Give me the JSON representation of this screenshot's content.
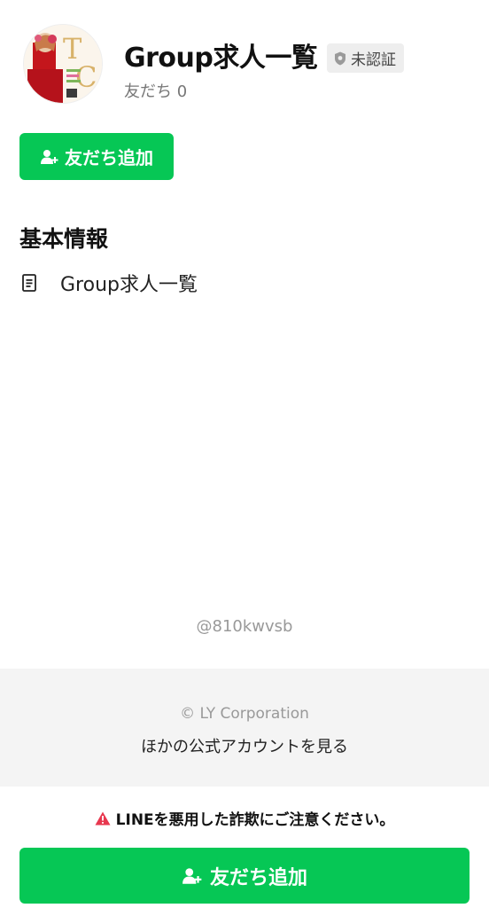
{
  "header": {
    "title": "Group求人一覧",
    "badge_label": "未認証",
    "friends_count": "友だち 0"
  },
  "actions": {
    "add_friend_label": "友だち追加"
  },
  "basic_info": {
    "section_title": "基本情報",
    "items": [
      {
        "icon": "document-icon",
        "text": "Group求人一覧"
      }
    ]
  },
  "account_id": "@810kwvsb",
  "footer": {
    "copyright": "© LY Corporation",
    "other_accounts_link": "ほかの公式アカウントを見る"
  },
  "bottom_bar": {
    "warning": "LINEを悪用した詐欺にご注意ください。",
    "add_friend_label": "友だち追加"
  },
  "colors": {
    "brand_green": "#06c755",
    "warning_red": "#e8384f",
    "footer_bg": "#f4f4f4",
    "badge_bg": "#eeeeee"
  }
}
